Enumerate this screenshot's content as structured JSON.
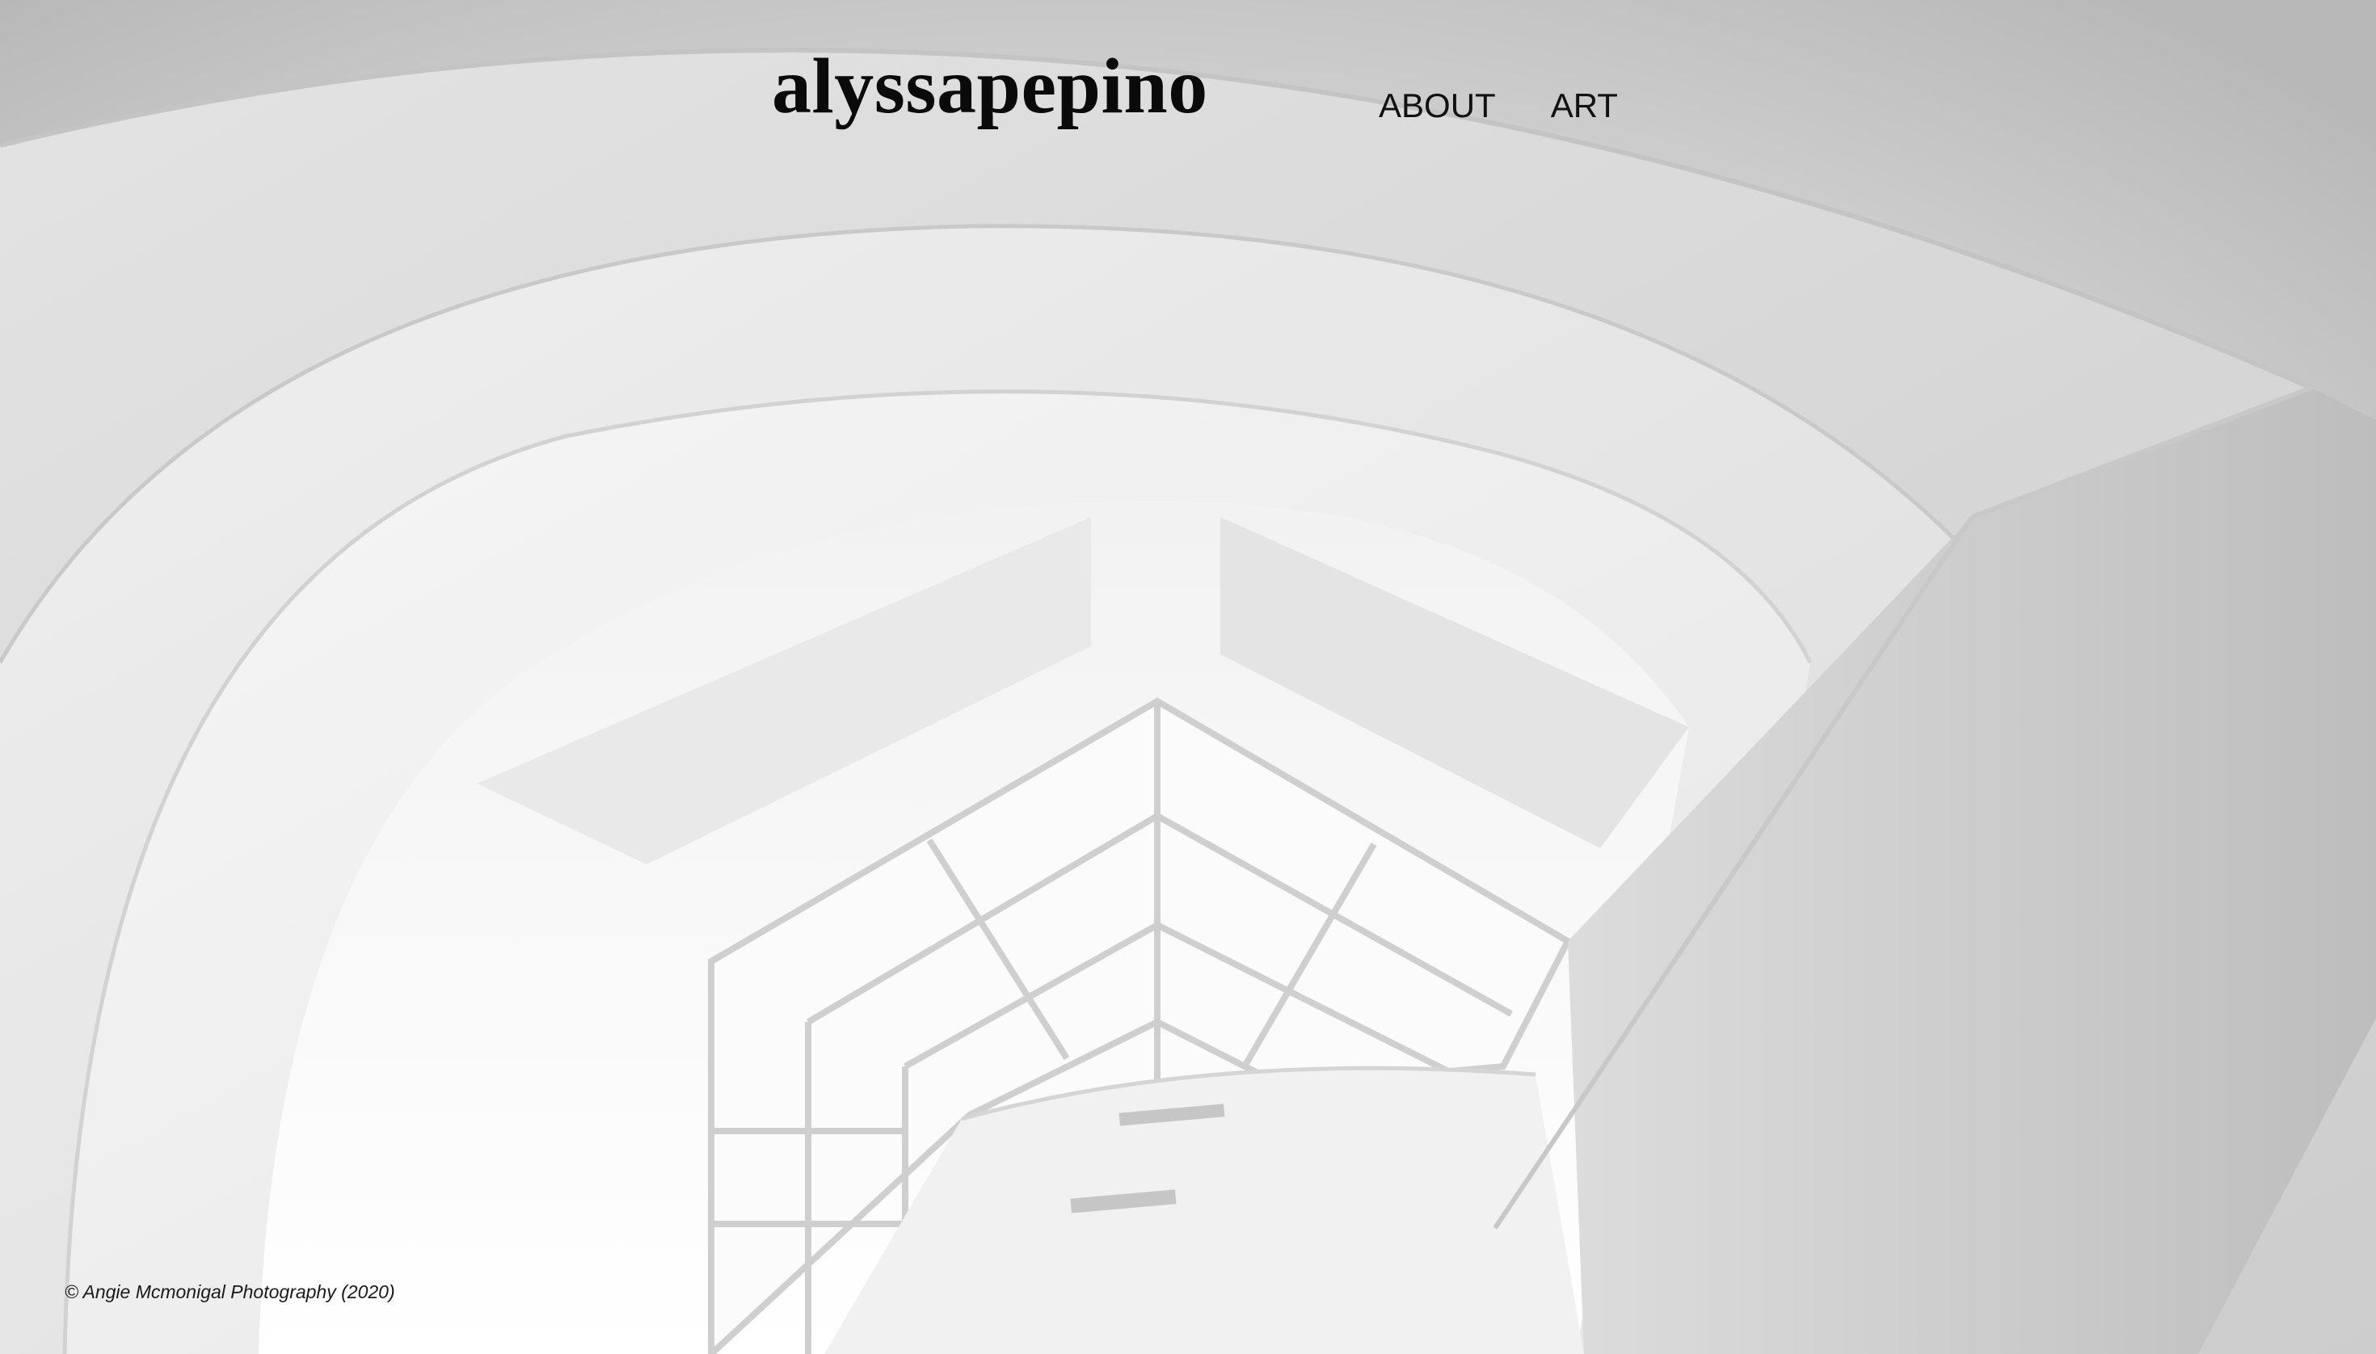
{
  "header": {
    "site_title": "alyssapepino",
    "nav": [
      {
        "label": "ABOUT"
      },
      {
        "label": "ART"
      }
    ]
  },
  "hero": {
    "description_icon": "architectural-skylight-photo",
    "credit": "© Angie Mcmonigal Photography (2020)"
  },
  "colors": {
    "text": "#0a0a0a",
    "background": "#e6e6e6"
  }
}
